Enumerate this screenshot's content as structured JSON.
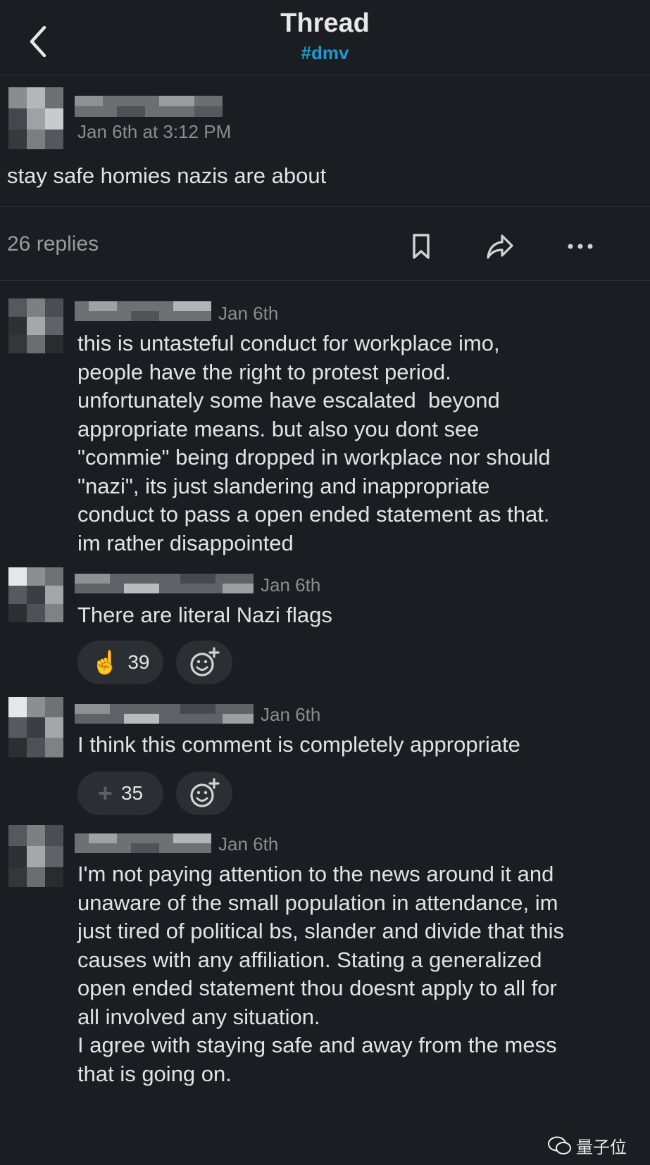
{
  "header": {
    "title": "Thread",
    "channel": "#dmv"
  },
  "parent": {
    "timestamp": "Jan 6th at 3:12 PM",
    "text": "stay safe homies nazis are about",
    "replies_count": "26 replies"
  },
  "replies": [
    {
      "date": "Jan 6th",
      "text": "this is untasteful conduct for workplace imo,\npeople have the right to protest period.\nunfortunately some have escalated  beyond\nappropriate means. but also you dont see\n\"commie\" being dropped in workplace nor should\n\"nazi\", its just slandering and inappropriate\nconduct to pass a open ended statement as that.\nim rather disappointed"
    },
    {
      "date": "Jan 6th",
      "text": "There are literal Nazi flags",
      "reaction": {
        "emoji": "☝",
        "count": "39"
      }
    },
    {
      "date": "Jan 6th",
      "text": "I think this comment is completely appropriate",
      "reaction": {
        "emoji": "+",
        "count": "35"
      }
    },
    {
      "date": "Jan 6th",
      "text": "I'm not paying attention to the news around it and\nunaware of the small population in attendance, im\njust tired of political bs, slander and divide that this\ncauses with any affiliation. Stating a generalized\nopen ended statement thou doesnt apply to all for\nall involved any situation.\nI agree with staying safe and away from the mess\nthat is going on."
    }
  ],
  "icons": {
    "back": "chevron-left-icon",
    "save": "bookmark-icon",
    "share": "share-icon",
    "more": "more-icon",
    "add_reaction": "add-reaction-icon"
  },
  "colors": {
    "background": "#1a1d21",
    "channel": "#1d9bd1",
    "text": "#e3e3e3",
    "muted": "#8c8d8f"
  },
  "watermark": "量子位"
}
